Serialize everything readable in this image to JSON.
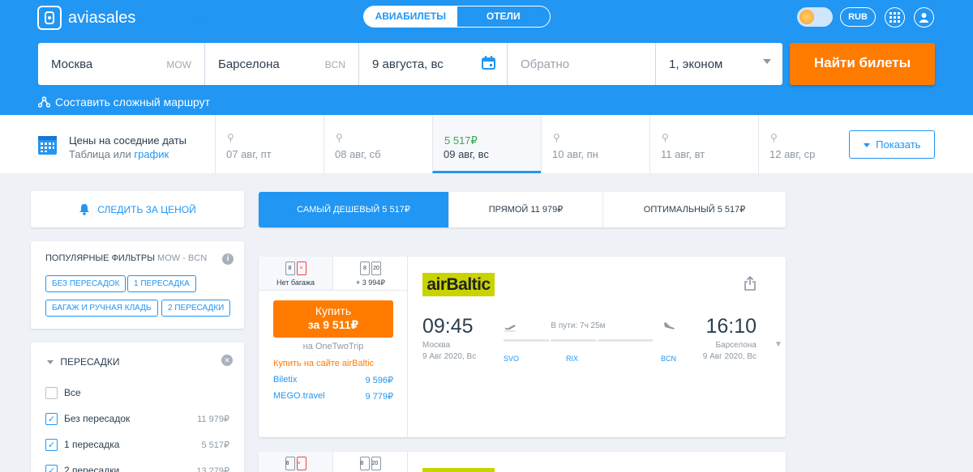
{
  "header": {
    "logo_text": "aviasales",
    "tabs": [
      {
        "label": "АВИАБИЛЕТЫ",
        "active": true
      },
      {
        "label": "ОТЕЛИ",
        "active": false
      }
    ],
    "currency": "RUB"
  },
  "search": {
    "from_city": "Москва",
    "from_code": "MOW",
    "to_city": "Барселона",
    "to_code": "BCN",
    "date": "9 августа, вс",
    "return_placeholder": "Обратно",
    "passengers": "1, эконом",
    "submit_label": "Найти билеты",
    "complex_route": "Составить сложный маршрут"
  },
  "dates": {
    "title": "Цены на соседние даты",
    "sub_table": "Таблица",
    "sub_or": "или",
    "sub_chart": "график",
    "days": [
      {
        "label": "07 авг, пт",
        "price": ""
      },
      {
        "label": "08 авг, сб",
        "price": ""
      },
      {
        "label": "09 авг, вс",
        "price": "5 517₽"
      },
      {
        "label": "10 авг, пн",
        "price": ""
      },
      {
        "label": "11 авг, вт",
        "price": ""
      },
      {
        "label": "12 авг, ср",
        "price": ""
      }
    ],
    "show_label": "Показать"
  },
  "sidebar": {
    "watch_label": "СЛЕДИТЬ ЗА ЦЕНОЙ",
    "popular_title": "ПОПУЛЯРНЫЕ ФИЛЬТРЫ",
    "popular_route": "MOW - BCN",
    "chips": [
      "БЕЗ ПЕРЕСАДОК",
      "1 ПЕРЕСАДКА",
      "БАГАЖ И РУЧНАЯ КЛАДЬ",
      "2 ПЕРЕСАДКИ"
    ],
    "stops_title": "ПЕРЕСАДКИ",
    "stops": [
      {
        "label": "Все",
        "price": "",
        "checked": false
      },
      {
        "label": "Без пересадок",
        "price": "11 979₽",
        "checked": true
      },
      {
        "label": "1 пересадка",
        "price": "5 517₽",
        "checked": true
      },
      {
        "label": "2 пересадки",
        "price": "13 279₽",
        "checked": true
      }
    ]
  },
  "sort_tabs": [
    {
      "label": "САМЫЙ ДЕШЕВЫЙ 5 517₽",
      "active": true
    },
    {
      "label": "ПРЯМОЙ 11 979₽",
      "active": false
    },
    {
      "label": "ОПТИМАЛЬНЫЙ 5 517₽",
      "active": false
    }
  ],
  "ticket": {
    "bag_options": [
      {
        "label": "Нет багажа",
        "icons": [
          "8",
          "×"
        ]
      },
      {
        "label": "+ 3 994₽",
        "icons": [
          "8",
          "20"
        ]
      }
    ],
    "buy_line1": "Купить",
    "buy_line2": "за 9 511₽",
    "via": "на OneTwoTrip",
    "buy_on_site": "Купить на сайте airBaltic",
    "agents": [
      {
        "name": "Biletix",
        "price": "9 596₽"
      },
      {
        "name": "MEGO.travel",
        "price": "9 779₽"
      }
    ],
    "airline": "airBaltic",
    "depart_time": "09:45",
    "depart_city": "Москва",
    "depart_date": "9 Авг 2020, Вс",
    "arrive_time": "16:10",
    "arrive_city": "Барселона",
    "arrive_date": "9 Авг 2020, Вс",
    "duration": "В пути: 7ч 25м",
    "airports": [
      "SVO",
      "RIX",
      "BCN"
    ]
  },
  "ticket2": {
    "bag_options": [
      {
        "icons": [
          "8",
          "×"
        ]
      },
      {
        "icons": [
          "8",
          "20"
        ]
      }
    ]
  },
  "colors": {
    "brand": "#2196f3",
    "accent": "#ff7b00",
    "green": "#3aa65a"
  }
}
